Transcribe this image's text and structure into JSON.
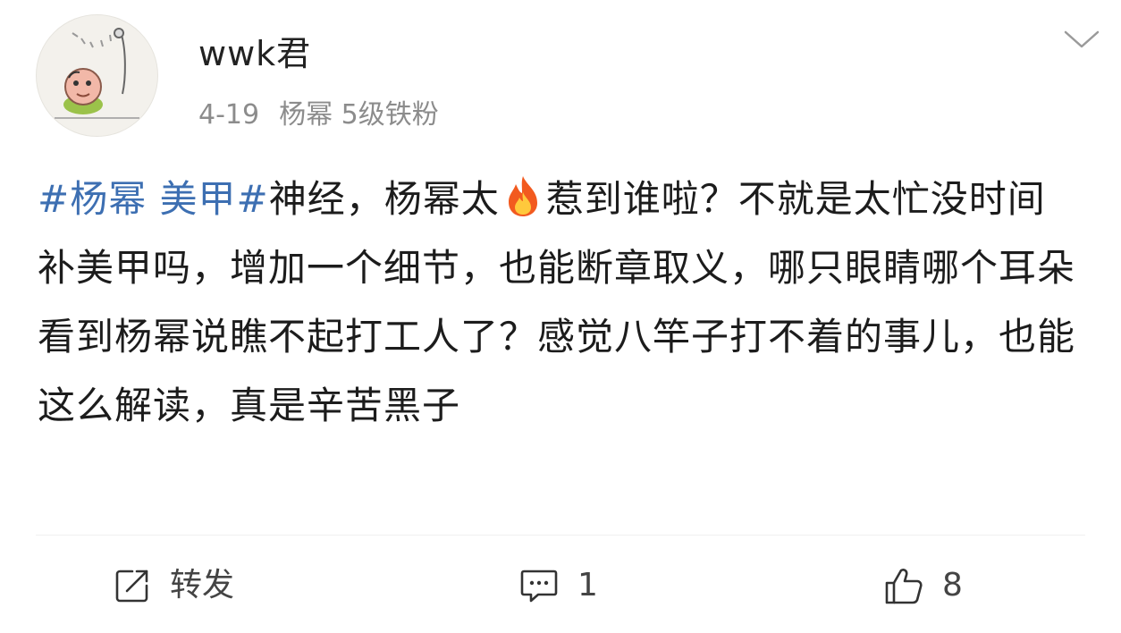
{
  "post": {
    "author": "wwk君",
    "date": "4-19",
    "fan_badge": "杨幂 5级铁粉",
    "content": {
      "hashtag": "#杨幂 美甲#",
      "segment_1": "神经，杨幂太",
      "segment_2": "惹到谁啦？不就是太忙没时间补美甲吗，增加一个细节，也能断章取义，哪只眼睛哪个耳朵看到杨幂说瞧不起打工人了？感觉八竿子打不着的事儿，也能这么解读，真是辛苦黑子"
    },
    "actions": {
      "repost_label": "转发",
      "comment_count": "1",
      "like_count": "8"
    }
  },
  "icons": {
    "avatar": "cartoon-avatar-icon",
    "more": "chevron-down-icon",
    "emoji": "fire-icon",
    "repost": "repost-icon",
    "comment": "comment-icon",
    "like": "thumbs-up-icon"
  },
  "colors": {
    "hashtag": "#3d6fb2",
    "meta_text": "#8c8c8c",
    "body_text": "#1c1c1c"
  }
}
